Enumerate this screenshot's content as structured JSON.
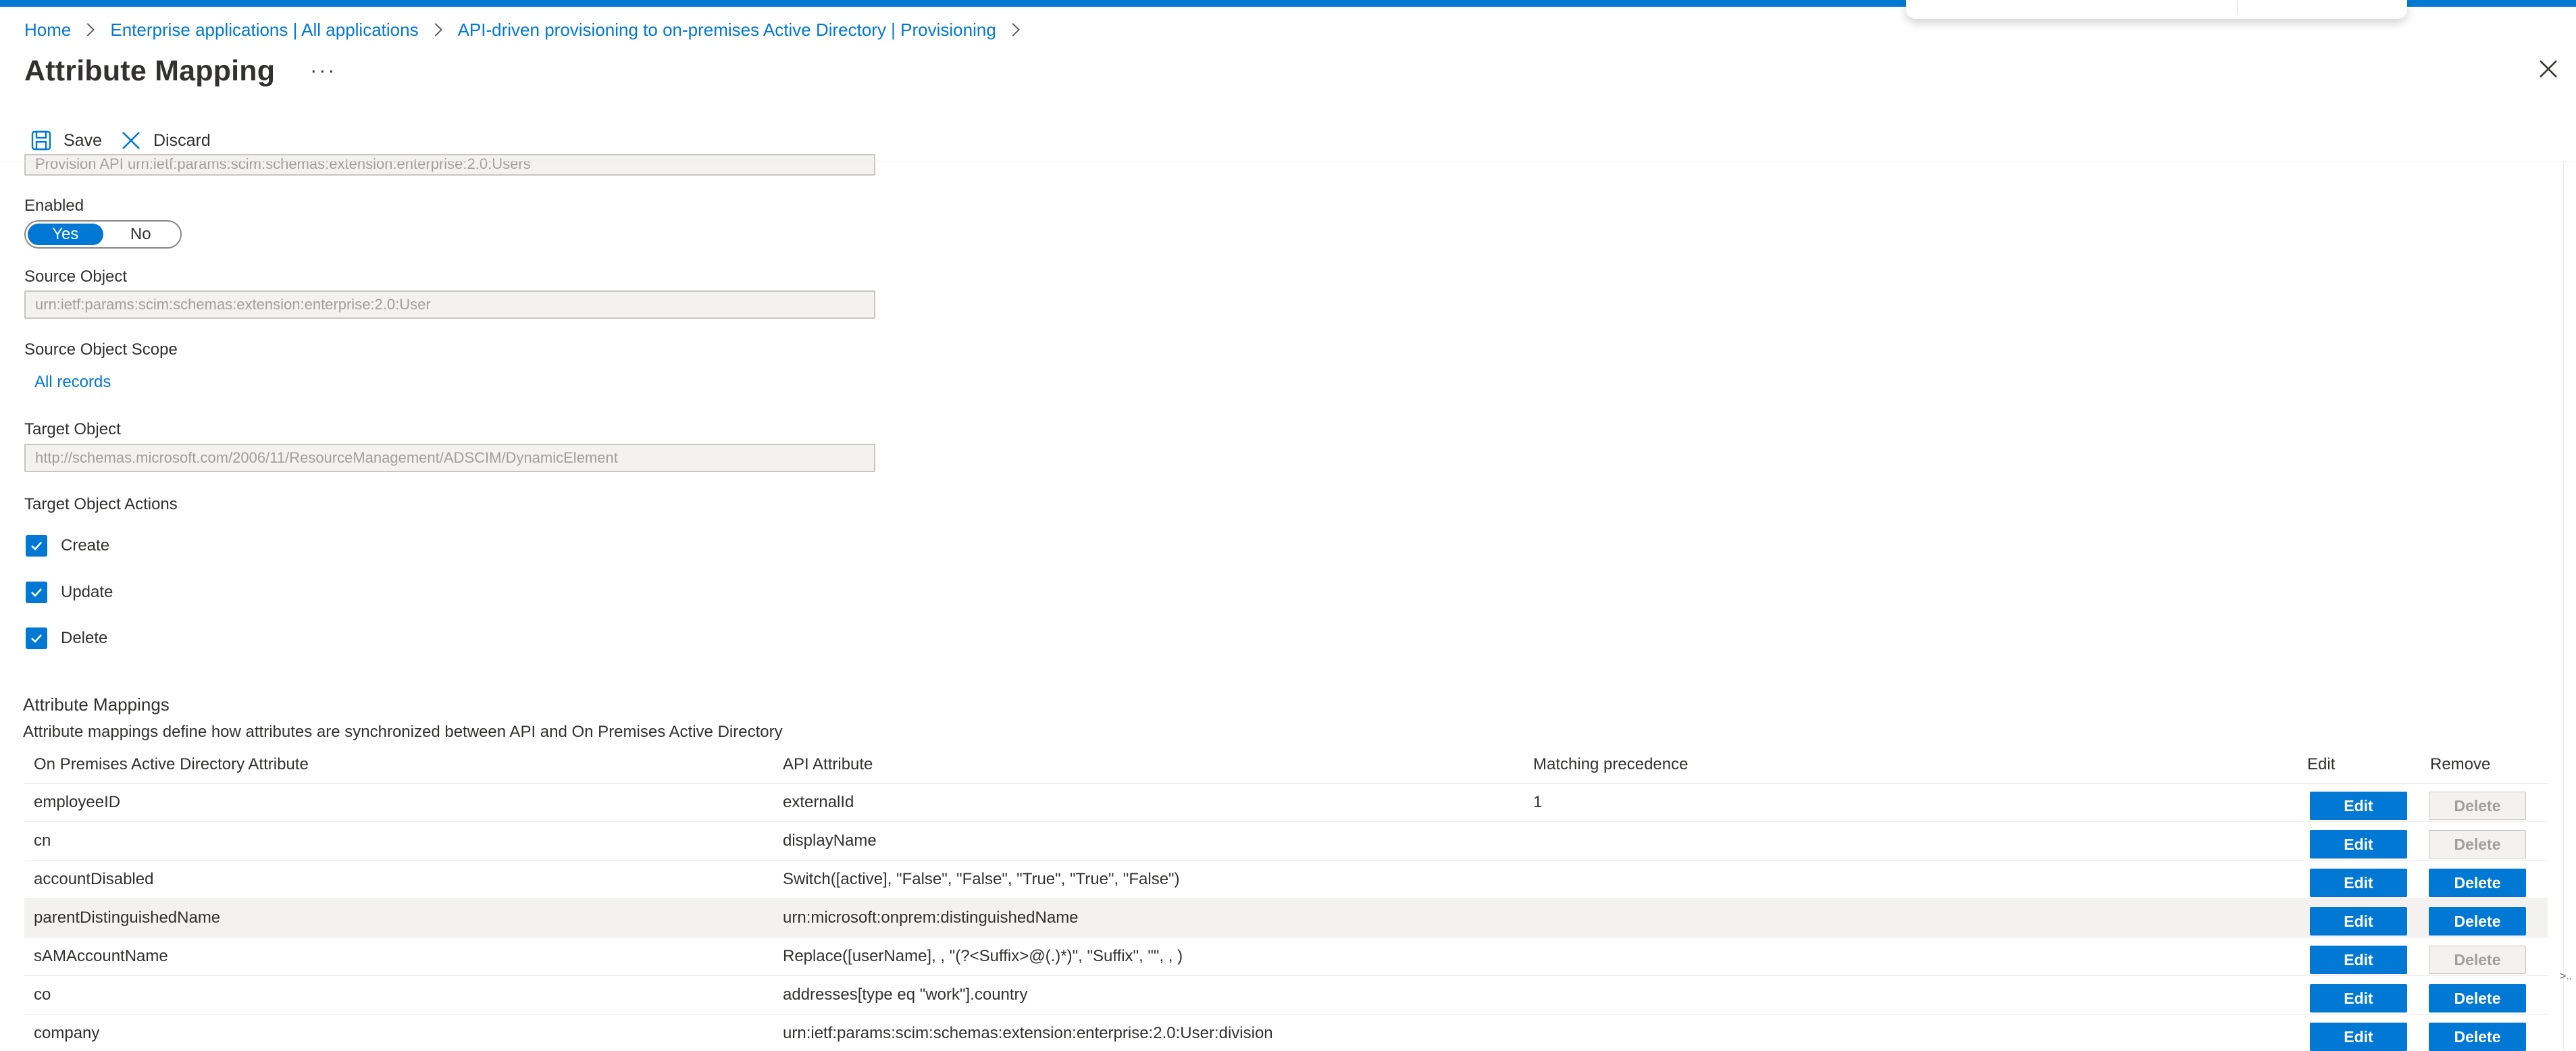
{
  "breadcrumb": [
    {
      "label": "Home"
    },
    {
      "label": "Enterprise applications | All applications"
    },
    {
      "label": "API-driven provisioning to on-premises Active Directory | Provisioning"
    }
  ],
  "page": {
    "title": "Attribute Mapping",
    "more_label": "···"
  },
  "toolbar": {
    "save_label": "Save",
    "discard_label": "Discard"
  },
  "form": {
    "name_value": "Provision API urn:ietf:params:scim:schemas:extension:enterprise:2.0:Users",
    "enabled_label": "Enabled",
    "enabled_yes": "Yes",
    "enabled_no": "No",
    "enabled_selected": "Yes",
    "source_object_label": "Source Object",
    "source_object_value": "urn:ietf:params:scim:schemas:extension:enterprise:2.0:User",
    "source_scope_label": "Source Object Scope",
    "source_scope_link": "All records",
    "target_object_label": "Target Object",
    "target_object_value": "http://schemas.microsoft.com/2006/11/ResourceManagement/ADSCIM/DynamicElement",
    "target_actions_label": "Target Object Actions",
    "actions": [
      {
        "label": "Create",
        "checked": true
      },
      {
        "label": "Update",
        "checked": true
      },
      {
        "label": "Delete",
        "checked": true
      }
    ]
  },
  "mappings": {
    "title": "Attribute Mappings",
    "description": "Attribute mappings define how attributes are synchronized between API and On Premises Active Directory",
    "columns": [
      "On Premises Active Directory Attribute",
      "API Attribute",
      "Matching precedence",
      "Edit",
      "Remove"
    ],
    "edit_label": "Edit",
    "delete_label": "Delete",
    "rows": [
      {
        "target": "employeeID",
        "source": "externalId",
        "precedence": "1",
        "delete_enabled": false
      },
      {
        "target": "cn",
        "source": "displayName",
        "precedence": "",
        "delete_enabled": false
      },
      {
        "target": "accountDisabled",
        "source": "Switch([active], \"False\", \"False\", \"True\", \"True\", \"False\")",
        "precedence": "",
        "delete_enabled": true
      },
      {
        "target": "parentDistinguishedName",
        "source": "urn:microsoft:onprem:distinguishedName",
        "precedence": "",
        "delete_enabled": true
      },
      {
        "target": "sAMAccountName",
        "source": "Replace([userName], , \"(?<Suffix>@(.)*)\", \"Suffix\", \"\", , )",
        "precedence": "",
        "delete_enabled": false
      },
      {
        "target": "co",
        "source": "addresses[type eq \"work\"].country",
        "precedence": "",
        "delete_enabled": true
      },
      {
        "target": "company",
        "source": "urn:ietf:params:scim:schemas:extension:enterprise:2.0:User:division",
        "precedence": "",
        "delete_enabled": true
      }
    ]
  },
  "edge_glyph": ">.."
}
